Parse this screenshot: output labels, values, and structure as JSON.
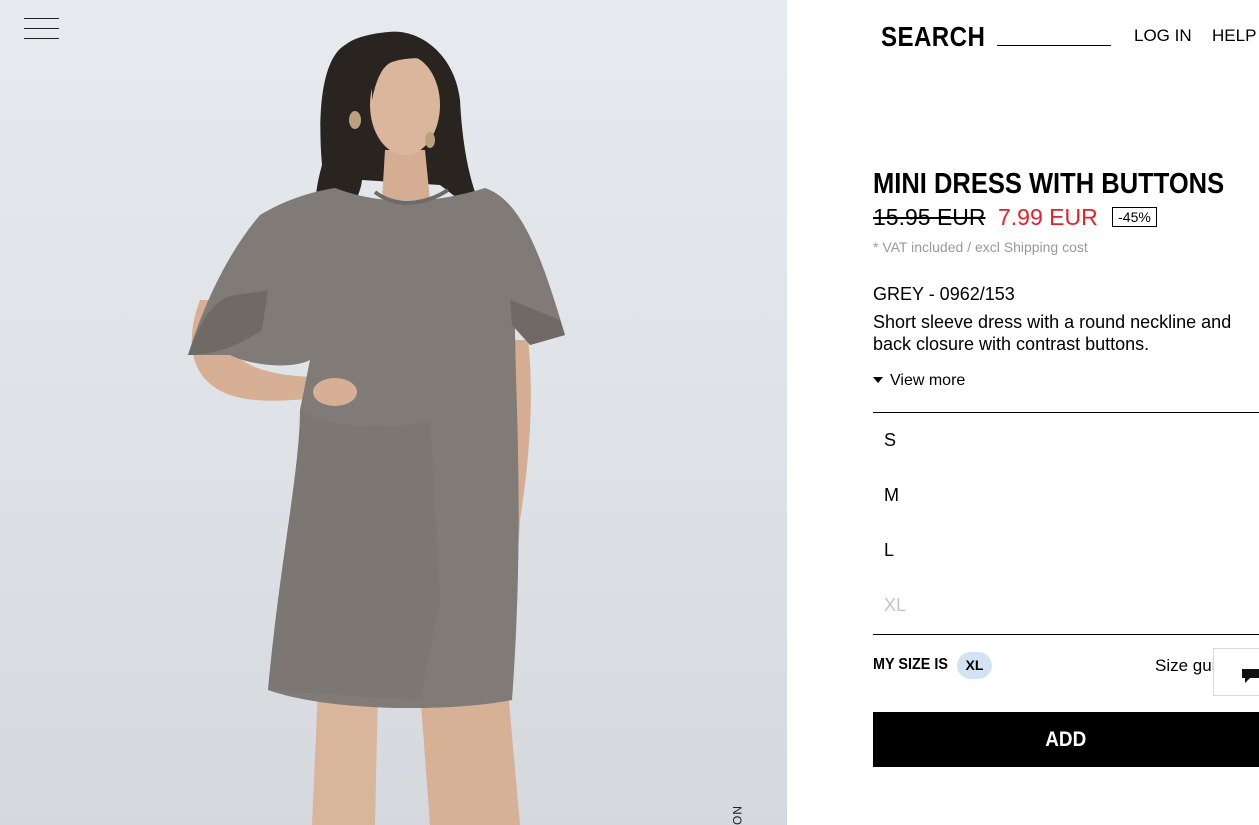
{
  "header": {
    "search_label": "SEARCH",
    "search_value": "",
    "login_label": "LOG IN",
    "help_label": "HELP"
  },
  "product": {
    "title": "MINI DRESS WITH BUTTONS",
    "old_price": "15.95 EUR",
    "new_price": "7.99 EUR",
    "discount": "-45%",
    "vat_note": "* VAT included / excl Shipping cost",
    "color_ref": "GREY - 0962/153",
    "description": "Short sleeve dress with a round neckline and back closure with contrast buttons.",
    "view_more": "View more",
    "sizes": [
      {
        "label": "S",
        "available": true
      },
      {
        "label": "M",
        "available": true
      },
      {
        "label": "L",
        "available": true
      },
      {
        "label": "XL",
        "available": false
      }
    ],
    "my_size_label": "MY SIZE IS",
    "my_size_value": "XL",
    "size_guide_label": "Size gui",
    "add_label": "ADD"
  },
  "image": {
    "vertical_text": "NO"
  },
  "colors": {
    "sale_red": "#e8202a",
    "badge_blue": "#d4e3f3",
    "photo_bg": "#e2e6ea",
    "dress_grey": "#807b77"
  },
  "icons": [
    "menu-icon",
    "caret-down-icon",
    "chat-icon"
  ]
}
